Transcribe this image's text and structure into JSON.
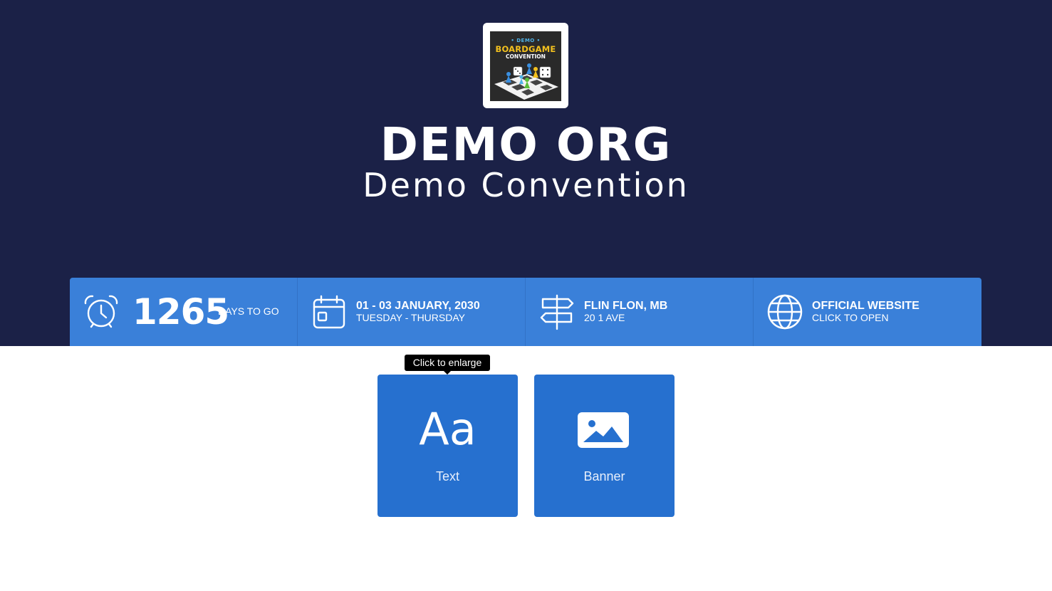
{
  "logo": {
    "demo_text": "• DEMO •",
    "title_text": "BOARDGAME",
    "sub_text": "CONVENTION"
  },
  "header": {
    "title": "DEMO ORG",
    "subtitle": "Demo Convention"
  },
  "info_bar": {
    "countdown": {
      "value": "1265",
      "label": "DAYS TO GO",
      "icon": "alarm-clock-icon"
    },
    "dates": {
      "line1": "01 - 03 JANUARY, 2030",
      "line2": "TUESDAY - THURSDAY",
      "icon": "calendar-icon"
    },
    "location": {
      "line1": "FLIN FLON, MB",
      "line2": "20 1 AVE",
      "icon": "signpost-icon"
    },
    "website": {
      "line1": "OFFICIAL WEBSITE",
      "line2": "CLICK TO OPEN",
      "icon": "globe-icon"
    }
  },
  "tooltip": {
    "text": "Click to enlarge"
  },
  "tiles": [
    {
      "label": "Text",
      "glyph": "Aa",
      "icon": "text-icon"
    },
    {
      "label": "Banner",
      "icon": "image-icon"
    }
  ],
  "colors": {
    "hero_bg": "#1b2147",
    "info_bar_bg": "#3a80d9",
    "tile_bg": "#2670cf",
    "tooltip_bg": "#000000"
  }
}
